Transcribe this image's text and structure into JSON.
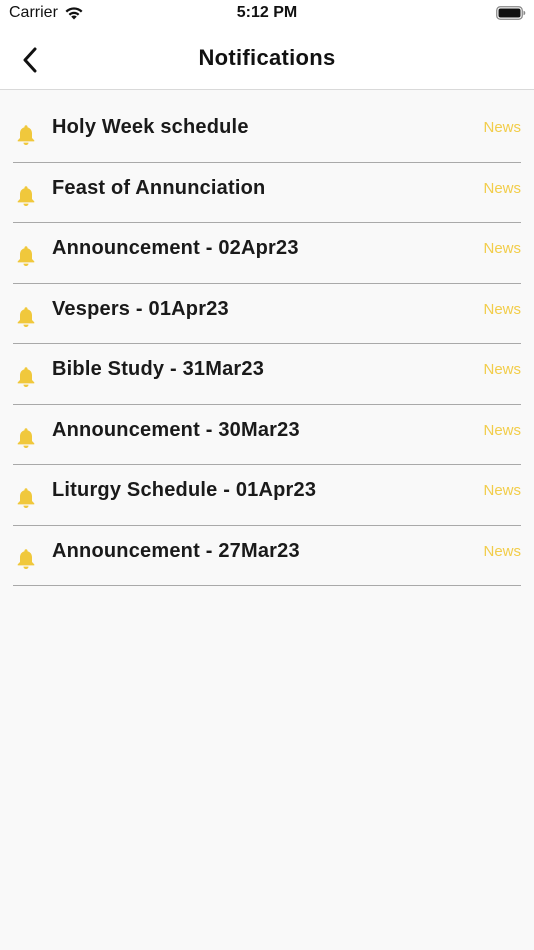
{
  "status_bar": {
    "carrier": "Carrier",
    "time": "5:12 PM"
  },
  "nav": {
    "title": "Notifications",
    "back_icon": "chevron-left-icon"
  },
  "colors": {
    "accent": "#f2cd4a",
    "bell": "#f0c83c"
  },
  "notifications": [
    {
      "title": "Holy Week schedule",
      "tag": "News",
      "icon": "bell-icon"
    },
    {
      "title": "Feast of Annunciation",
      "tag": "News",
      "icon": "bell-icon"
    },
    {
      "title": "Announcement - 02Apr23",
      "tag": "News",
      "icon": "bell-icon"
    },
    {
      "title": "Vespers - 01Apr23",
      "tag": "News",
      "icon": "bell-icon"
    },
    {
      "title": "Bible Study - 31Mar23",
      "tag": "News",
      "icon": "bell-icon"
    },
    {
      "title": "Announcement - 30Mar23",
      "tag": "News",
      "icon": "bell-icon"
    },
    {
      "title": "Liturgy Schedule - 01Apr23",
      "tag": "News",
      "icon": "bell-icon"
    },
    {
      "title": "Announcement - 27Mar23",
      "tag": "News",
      "icon": "bell-icon"
    }
  ]
}
